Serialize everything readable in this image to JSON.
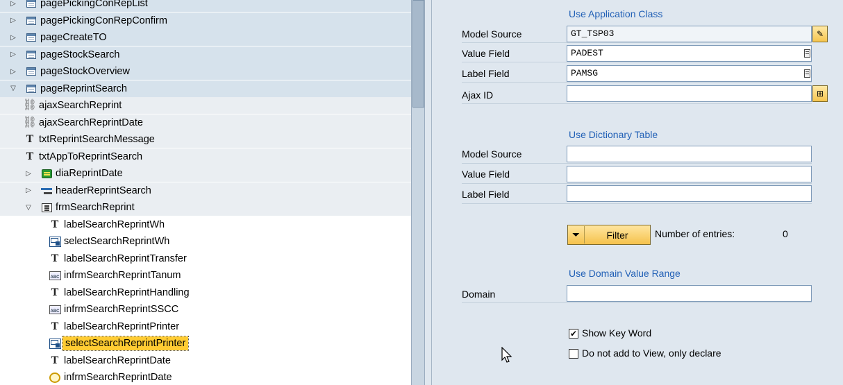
{
  "tree": {
    "items": [
      {
        "label": "pagePickingConRepList",
        "icon": "page-icon",
        "expander": "collapsed",
        "indent": 0
      },
      {
        "label": "pagePickingConRepConfirm",
        "icon": "page-icon",
        "expander": "collapsed",
        "indent": 0
      },
      {
        "label": "pageCreateTO",
        "icon": "page-icon",
        "expander": "collapsed",
        "indent": 0
      },
      {
        "label": "pageStockSearch",
        "icon": "page-icon",
        "expander": "collapsed",
        "indent": 0
      },
      {
        "label": "pageStockOverview",
        "icon": "page-icon",
        "expander": "collapsed",
        "indent": 0
      },
      {
        "label": "pageReprintSearch",
        "icon": "page-icon",
        "expander": "expanded",
        "indent": 0
      },
      {
        "label": "ajaxSearchReprint",
        "icon": "ajax-icon",
        "expander": "none",
        "indent": 1
      },
      {
        "label": "ajaxSearchReprintDate",
        "icon": "ajax-icon",
        "expander": "none",
        "indent": 1
      },
      {
        "label": "txtReprintSearchMessage",
        "icon": "text-icon",
        "expander": "none",
        "indent": 1
      },
      {
        "label": "txtAppToReprintSearch",
        "icon": "text-icon",
        "expander": "none",
        "indent": 1
      },
      {
        "label": "diaReprintDate",
        "icon": "dialog-icon",
        "expander": "collapsed",
        "indent": 1
      },
      {
        "label": "headerReprintSearch",
        "icon": "header-icon",
        "expander": "collapsed",
        "indent": 1
      },
      {
        "label": "frmSearchReprint",
        "icon": "form-icon",
        "expander": "expanded",
        "indent": 1
      },
      {
        "label": "labelSearchReprintWh",
        "icon": "text-icon",
        "expander": "none",
        "indent": 2
      },
      {
        "label": "selectSearchReprintWh",
        "icon": "select-icon",
        "expander": "none",
        "indent": 2
      },
      {
        "label": "labelSearchReprintTransfer",
        "icon": "text-icon",
        "expander": "none",
        "indent": 2
      },
      {
        "label": "infrmSearchReprintTanum",
        "icon": "input-icon",
        "expander": "none",
        "indent": 2
      },
      {
        "label": "labelSearchReprintHandling",
        "icon": "text-icon",
        "expander": "none",
        "indent": 2
      },
      {
        "label": "infrmSearchReprintSSCC",
        "icon": "input-icon",
        "expander": "none",
        "indent": 2
      },
      {
        "label": "labelSearchReprintPrinter",
        "icon": "text-icon",
        "expander": "none",
        "indent": 2
      },
      {
        "label": "selectSearchReprintPrinter",
        "icon": "select-icon",
        "expander": "none",
        "indent": 2,
        "selected": true
      },
      {
        "label": "labelSearchReprintDate",
        "icon": "text-icon",
        "expander": "none",
        "indent": 2
      },
      {
        "label": "infrmSearchReprintDate",
        "icon": "date-icon",
        "expander": "none",
        "indent": 2
      }
    ]
  },
  "props": {
    "app_class": {
      "title": "Use Application Class",
      "model_source_label": "Model Source",
      "model_source_value": "GT_TSP03",
      "value_field_label": "Value Field",
      "value_field_value": "PADEST",
      "label_field_label": "Label Field",
      "label_field_value": "PAMSG",
      "ajax_id_label": "Ajax ID",
      "ajax_id_value": ""
    },
    "dictionary": {
      "title": "Use Dictionary Table",
      "model_source_label": "Model Source",
      "model_source_value": "",
      "value_field_label": "Value Field",
      "value_field_value": "",
      "label_field_label": "Label Field",
      "label_field_value": "",
      "filter_label": "Filter",
      "entries_label": "Number of entries:",
      "entries_value": "0"
    },
    "domain": {
      "title": "Use Domain Value Range",
      "domain_label": "Domain",
      "domain_value": ""
    },
    "options": {
      "show_key_word_label": "Show Key Word",
      "show_key_word_checked": true,
      "do_not_add_label": "Do not add to View, only declare",
      "do_not_add_checked": false
    }
  }
}
